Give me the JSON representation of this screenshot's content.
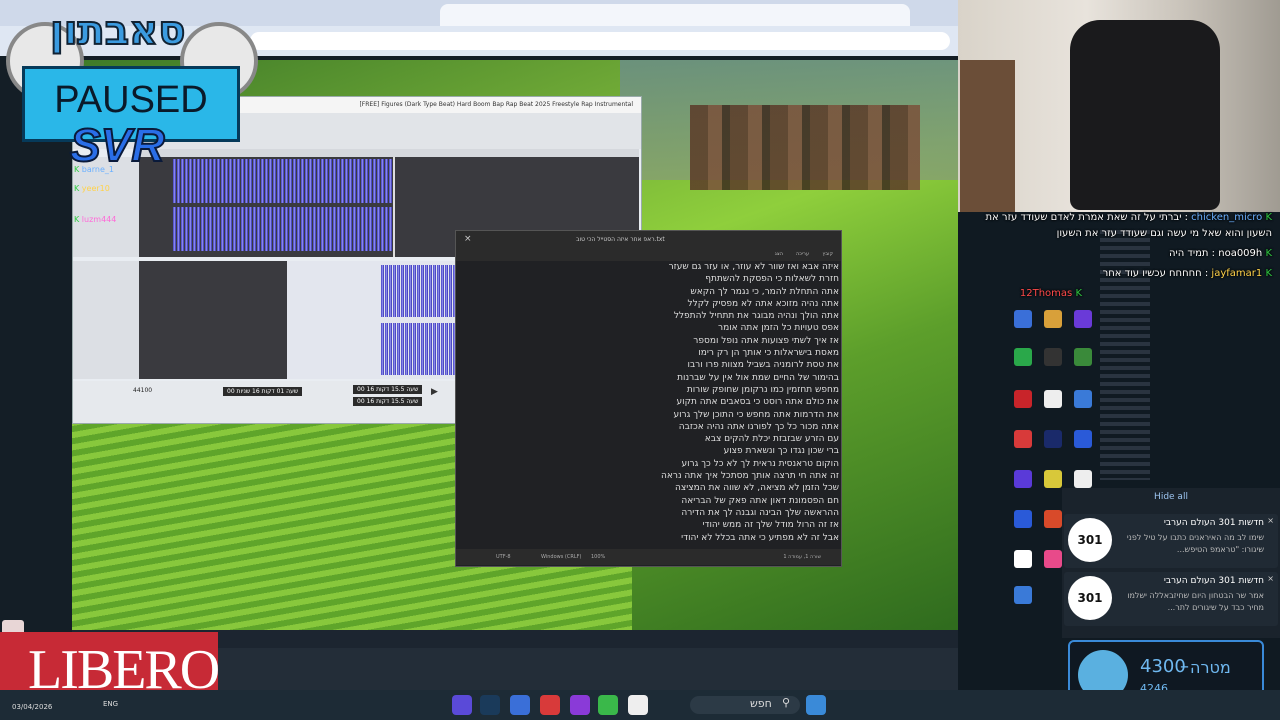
{
  "overlay": {
    "logo_text": "סאבתון",
    "paused_label": "PAUSED",
    "svr_label": "SVR",
    "libero_label": "LIBERO"
  },
  "chat_left": [
    {
      "user": "barne_1",
      "msg": ""
    },
    {
      "user": "yeer10",
      "msg": ""
    },
    {
      "user": "luzm444",
      "msg": ""
    }
  ],
  "chat_right": [
    {
      "user": "chicken_micro",
      "msg": "יברתי על זה שאת אמרת לאדם שעודד עזר את"
    },
    {
      "user": "",
      "msg": "השעון והוא שאל מי עשה וגם שעודד עזר את השעון"
    },
    {
      "user": "noa009h",
      "msg": "תמיד היה"
    },
    {
      "user": "jayfamar1",
      "msg": "חחחחח עכשיו עוד אחר"
    },
    {
      "user": "12Thomas",
      "msg": ""
    }
  ],
  "audio_editor": {
    "title": "[FREE] Figures (Dark Type Beat) Hard Boom Bap Rap Beat 2025 Freestyle Rap Instrumental",
    "time_display": "00 שעה 01 דקות 16 שניות",
    "selection_start": "00 שעה 15.5 דקות 16",
    "selection_end": "00 שעה 15.5 דקות 16",
    "rate": "44100"
  },
  "notepad": {
    "title": "ראפ אחר איזה הסטייל הכי טוב.txt",
    "menu": [
      "קובץ",
      "עריכה",
      "הצג"
    ],
    "lines": [
      "איזה אבא ואז שוור לא עוזר, או עזר גם שעזר ",
      "חזרת לשאלות כי הפסקת להשתתף",
      "אתה התחלת להמר, כי נגמר לך הקאש",
      "אתה נהיה מזוכא אתה לא מפסיק לקלל",
      "אתה הולך ונהיה מבוגר את תתחיל להתפלל",
      "אפס טעויות כל הזמן אתה אומר",
      "אז איך לשתי פצועות אתה נופל ומספר",
      "מאסת בישראלות כי אותך הן רק רימו",
      "את טסת לרומניה בשביל מצוות פרו ורבו",
      "בהימור של החיים שמת אול אין על שברנות",
      "מחפש תחזמין כמו נרקומן שחופק שורות",
      "את כולם אתה רוסט כי בסאבים אתה תקוע",
      "את הדרמות אתה מחפש כי התוכן שלך גרוע",
      "אתה מכור כל כך לפורנו אתה נהיה אכזבה",
      "עם הזרע שבזבזת יכלת להקים צבא",
      "ברי שכון נגדו כך ונשארת פצוע",
      "הוקום טראנסית נראית לך לא כל כך גרוע",
      "זה אתה חי תרצה אותך מסתכל איך אתה נראה",
      "שכל הזמן לא מציאה, לא שווה את המציצה",
      "חם הפסמונת דאון אתה פאק של הבריאה",
      "ההראשה שלך הבינה וגבנה לך את הדירה",
      "אז זה הרול מודל שלך זה ממש יהודי",
      "אבל זה לא מפתיע כי אתה בכלל לא יהודי"
    ],
    "status": [
      "UTF-8",
      "Windows (CRLF)",
      "100%",
      "שורה 1, עמודה 1"
    ]
  },
  "notifications": {
    "hide_all": "Hide all",
    "items": [
      {
        "title": "חדשות 301 העולם הערבי",
        "body": "שימו לב מה האיראנים כתבו על טיל לפני שיגורו: \"טראמפ הטיפש...",
        "logo": "301"
      },
      {
        "title": "חדשות 301 העולם הערבי",
        "body": "אמר שר הבטחון היום שחיזבאללה ישלמו מחיר כבד על שיגורים לתר...",
        "logo": "301"
      }
    ]
  },
  "goal": {
    "label": "מטרה",
    "value": "4300",
    "dash": "–",
    "current": "4246"
  },
  "taskbar": {
    "search_label": "חפש",
    "date": "03/04/2026",
    "lang": "ENG"
  },
  "colors": {
    "accent": "#3a8ad8",
    "waveform": "#5a58d0",
    "libero": "#c72a36",
    "paused_bg": "#2ab7e8"
  }
}
